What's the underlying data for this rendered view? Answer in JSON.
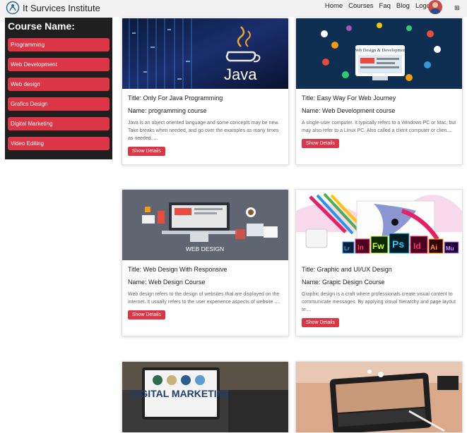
{
  "header": {
    "brand": "It Survices Institute",
    "nav": [
      "Home",
      "Courses",
      "Faq",
      "Blog",
      "Logout"
    ],
    "menu_icon": "grid-icon"
  },
  "sidebar": {
    "title": "Course Name:",
    "items": [
      {
        "label": "Programming"
      },
      {
        "label": "Web Development"
      },
      {
        "label": "Web design"
      },
      {
        "label": "Grafics Design"
      },
      {
        "label": "Digital Marketing"
      },
      {
        "label": "Video Editing"
      }
    ]
  },
  "courses": [
    {
      "title": "Title: Only For Java Programming",
      "name": "Name: programming course",
      "desc": "Java is an object oriented language and some concepts may be new. Take breaks when needed, and go over the examples as many times as needed.....",
      "button": "Show Details",
      "image_text": "Java"
    },
    {
      "title": "Title: Easy Way For Web Journey",
      "name": "Name: Web Development course",
      "desc": "A single-user computer. It typically refers to a Windows PC or Mac, but may also refer to a Linux PC. Also called a client computer or clien....",
      "button": "Show Details",
      "image_text": "Web Design & Development"
    },
    {
      "title": "Title: Web Design With Responsive",
      "name": "Name: Web Design Course",
      "desc": "Web design refers to the design of websites that are displayed on the internet. It usually refers to the user experience aspects of website ....",
      "button": "Show Details",
      "image_text": "WEB DESIGN"
    },
    {
      "title": "Title: Graphic and UI/UX Design",
      "name": "Name: Grapic Design Course",
      "desc": "Graphic design is a craft where professionals create visual content to communicate messages. By applying visual hierarchy and page layout te....",
      "button": "Show Details",
      "image_text": [
        "Lr",
        "In",
        "Fw",
        "Ps",
        "Id",
        "Ai",
        "Mu"
      ]
    },
    {
      "image_text": "DIGITAL MARKETING"
    },
    {
      "image_text": ""
    }
  ],
  "colors": {
    "accent": "#dc3545",
    "sidebar_bg": "#1f1f1f",
    "navbar_bg": "#f2f2f2"
  }
}
